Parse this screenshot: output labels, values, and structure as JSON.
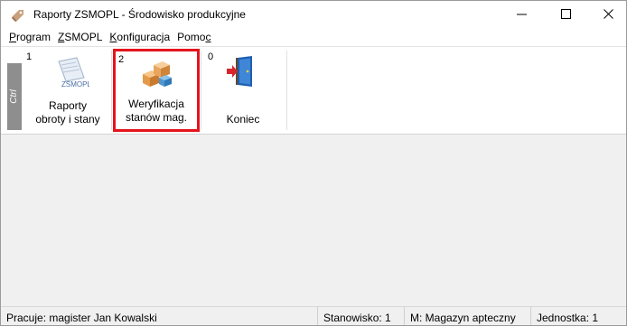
{
  "window": {
    "title": "Raporty ZSMOPL - Środowisko produkcyjne",
    "controls": {
      "minimize": "—",
      "maximize": "☐",
      "close": "✕"
    }
  },
  "menu": {
    "items": [
      {
        "pre": "",
        "ul": "P",
        "post": "rogram"
      },
      {
        "pre": "",
        "ul": "Z",
        "post": "SMOPL"
      },
      {
        "pre": "",
        "ul": "K",
        "post": "onfiguracja"
      },
      {
        "pre": "Pomo",
        "ul": "c",
        "post": ""
      }
    ]
  },
  "toolbar": {
    "side_label": "Ctrl",
    "buttons": [
      {
        "number": "1",
        "icon": "zsmopl-report-icon",
        "icon_text": "ZSMOPL",
        "line1": "Raporty",
        "line2": "obroty i stany"
      },
      {
        "number": "2",
        "icon": "boxes-icon",
        "line1": "Weryfikacja",
        "line2": "stanów mag."
      },
      {
        "number": "0",
        "icon": "exit-door-icon",
        "line1": "",
        "line2": "Koniec"
      }
    ],
    "highlight_color": "#e4141d"
  },
  "status": {
    "user": "Pracuje: magister Jan Kowalski",
    "station": "Stanowisko: 1",
    "warehouse": "M: Magazyn apteczny",
    "unit": "Jednostka: 1"
  }
}
